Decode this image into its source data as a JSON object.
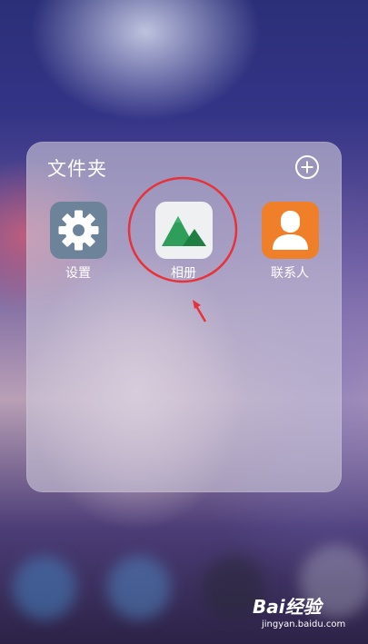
{
  "folder": {
    "title": "文件夹",
    "add_icon": "plus-circle-icon"
  },
  "apps": [
    {
      "label": "设置",
      "icon": "gear-icon",
      "color": "#6d8399"
    },
    {
      "label": "相册",
      "icon": "mountain-icon",
      "color": "#eef0f2"
    },
    {
      "label": "联系人",
      "icon": "person-icon",
      "color": "#f07f2a"
    }
  ],
  "annotation": {
    "color": "#e8323a"
  },
  "watermark": {
    "brand": "Bai经验",
    "url": "jingyan.baidu.com"
  }
}
